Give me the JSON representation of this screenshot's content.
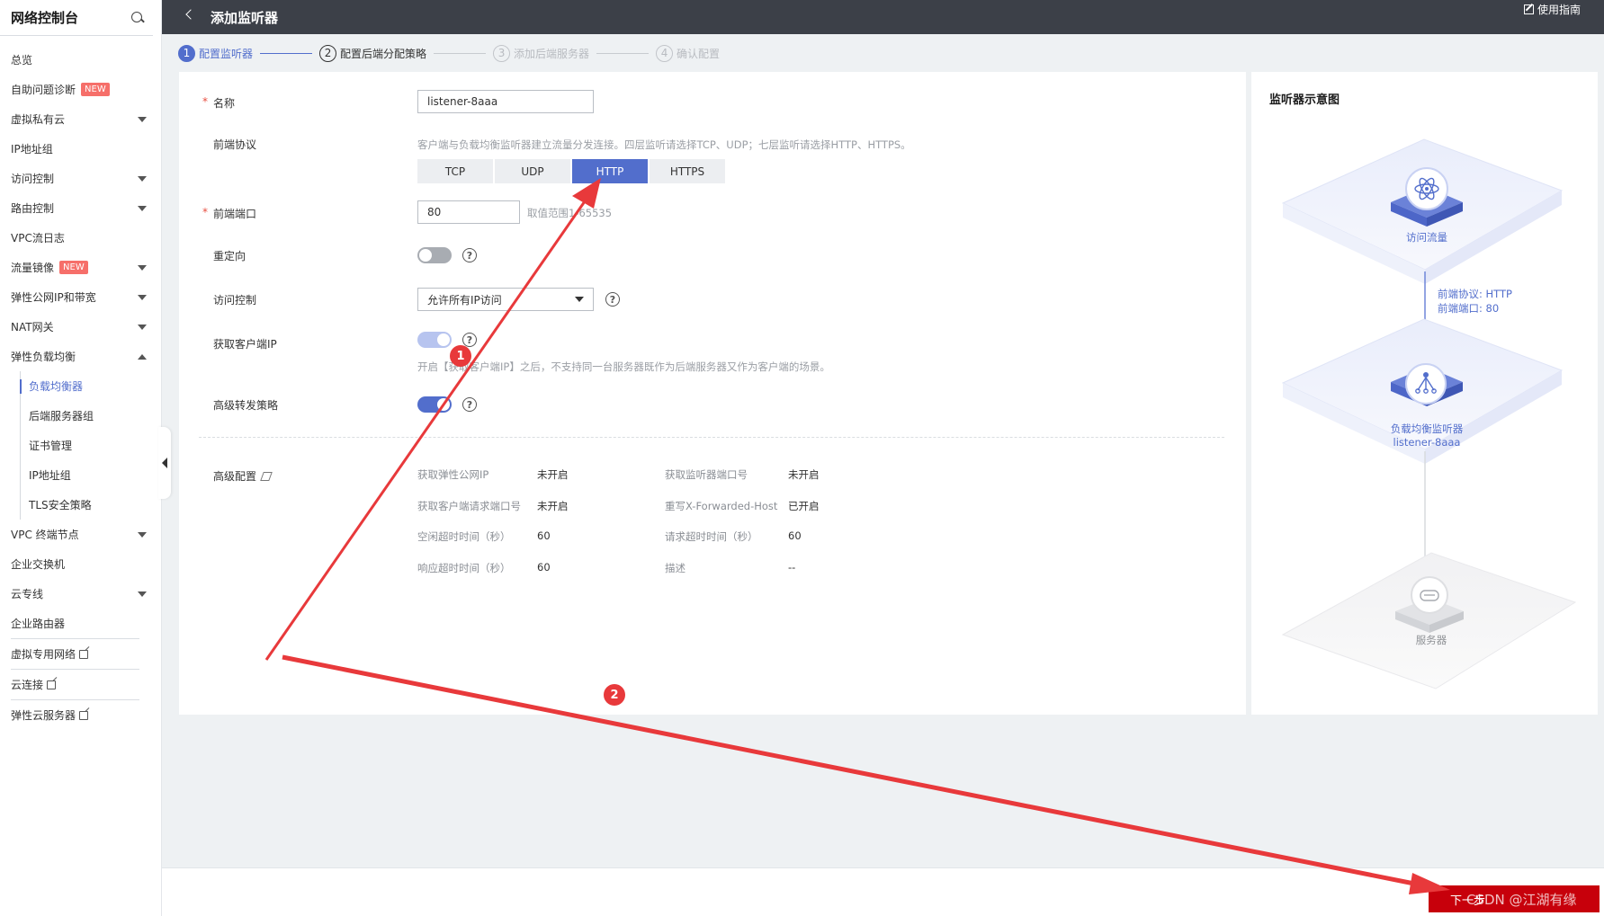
{
  "sidebar": {
    "title": "网络控制台",
    "items": [
      {
        "label": "总览",
        "expand": "none"
      },
      {
        "label": "自助问题诊断",
        "badge": "NEW",
        "expand": "none"
      },
      {
        "label": "虚拟私有云",
        "expand": "down"
      },
      {
        "label": "IP地址组",
        "expand": "none"
      },
      {
        "label": "访问控制",
        "expand": "down"
      },
      {
        "label": "路由控制",
        "expand": "down"
      },
      {
        "label": "VPC流日志",
        "expand": "none"
      },
      {
        "label": "流量镜像",
        "badge": "NEW",
        "expand": "down"
      },
      {
        "label": "弹性公网IP和带宽",
        "expand": "down"
      },
      {
        "label": "NAT网关",
        "expand": "down"
      },
      {
        "label": "弹性负载均衡",
        "expand": "up"
      }
    ],
    "sub_items": [
      "负载均衡器",
      "后端服务器组",
      "证书管理",
      "IP地址组",
      "TLS安全策略"
    ],
    "items_after": [
      {
        "label": "VPC 终端节点",
        "expand": "down"
      },
      {
        "label": "企业交换机",
        "expand": "none"
      },
      {
        "label": "云专线",
        "expand": "down"
      },
      {
        "label": "企业路由器",
        "expand": "none"
      }
    ],
    "external_links": [
      "虚拟专用网络",
      "云连接",
      "弹性云服务器"
    ]
  },
  "topbar": {
    "title": "添加监听器",
    "guide": "使用指南"
  },
  "steps": [
    {
      "num": "1",
      "label": "配置监听器"
    },
    {
      "num": "2",
      "label": "配置后端分配策略"
    },
    {
      "num": "3",
      "label": "添加后端服务器"
    },
    {
      "num": "4",
      "label": "确认配置"
    }
  ],
  "form": {
    "name_label": "名称",
    "name_value": "listener-8aaa",
    "protocol_label": "前端协议",
    "protocol_hint": "客户端与负载均衡监听器建立流量分发连接。四层监听请选择TCP、UDP；七层监听请选择HTTP、HTTPS。",
    "protocols": [
      "TCP",
      "UDP",
      "HTTP",
      "HTTPS"
    ],
    "protocol_selected": "HTTP",
    "port_label": "前端端口",
    "port_value": "80",
    "port_hint": "取值范围1-65535",
    "redirect_label": "重定向",
    "access_label": "访问控制",
    "access_value": "允许所有IP访问",
    "client_ip_label": "获取客户端IP",
    "client_ip_hint": "开启【获取客户端IP】之后，不支持同一台服务器既作为后端服务器又作为客户端的场景。",
    "advanced_policy_label": "高级转发策略",
    "advanced_label": "高级配置"
  },
  "advanced": [
    {
      "k1": "获取弹性公网IP",
      "v1": "未开启",
      "k2": "获取监听器端口号",
      "v2": "未开启"
    },
    {
      "k1": "获取客户端请求端口号",
      "v1": "未开启",
      "k2": "重写X-Forwarded-Host",
      "v2": "已开启"
    },
    {
      "k1": "空闲超时时间（秒）",
      "v1": "60",
      "k2": "请求超时时间（秒）",
      "v2": "60"
    },
    {
      "k1": "响应超时时间（秒）",
      "v1": "60",
      "k2": "描述",
      "v2": "--"
    }
  ],
  "diagram": {
    "title": "监听器示意图",
    "traffic": "访问流量",
    "protocol_line": "前端协议: HTTP",
    "port_line": "前端端口: 80",
    "listener": "负载均衡监听器",
    "listener_name": "listener-8aaa",
    "server": "服务器"
  },
  "bottom": {
    "next_label": "下一步",
    "watermark": "CSDN @江湖有缘"
  },
  "annotations": [
    "1",
    "2"
  ],
  "colors": {
    "accent": "#526ecc",
    "arrow": "#e8393b",
    "primary_button": "#c7000b",
    "topbar": "#3c4048"
  }
}
